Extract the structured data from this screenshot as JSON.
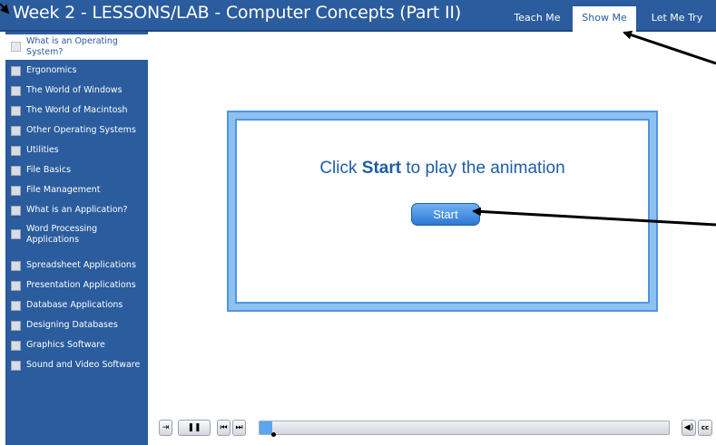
{
  "header": {
    "title": "Week 2 - LESSONS/LAB - Computer Concepts (Part II)",
    "tabs": [
      {
        "label": "Teach Me",
        "active": false
      },
      {
        "label": "Show Me",
        "active": true
      },
      {
        "label": "Let Me Try",
        "active": false
      }
    ]
  },
  "sidebar": {
    "items": [
      {
        "label": "What is an Operating System?",
        "active": true
      },
      {
        "label": "Ergonomics"
      },
      {
        "label": "The World of Windows"
      },
      {
        "label": "The World of Macintosh"
      },
      {
        "label": "Other Operating Systems"
      },
      {
        "label": "Utilities"
      },
      {
        "label": "File Basics"
      },
      {
        "label": "File Management"
      },
      {
        "label": "What is an Application?"
      },
      {
        "label": "Word Processing Applications"
      },
      {
        "label": "Spreadsheet Applications"
      },
      {
        "label": "Presentation Applications"
      },
      {
        "label": "Database Applications"
      },
      {
        "label": "Designing Databases"
      },
      {
        "label": "Graphics Software"
      },
      {
        "label": "Sound and Video Software"
      }
    ]
  },
  "stage": {
    "prompt_before": "Click ",
    "prompt_bold": "Start",
    "prompt_after": " to play the animation",
    "start_button": "Start"
  },
  "player": {
    "exit_icon": "exit-icon",
    "pause_icon": "pause-icon",
    "prev_icon": "previous-icon",
    "next_icon": "next-icon",
    "volume_icon": "volume-icon",
    "cc_label": "cc",
    "progress": 0.03
  },
  "colors": {
    "header": "#2a5c9e",
    "sidebar": "#2a5c9e",
    "stage_border": "#4f95df",
    "prompt_text": "#1f5ca6",
    "progress_fill": "#5aa6f0"
  }
}
